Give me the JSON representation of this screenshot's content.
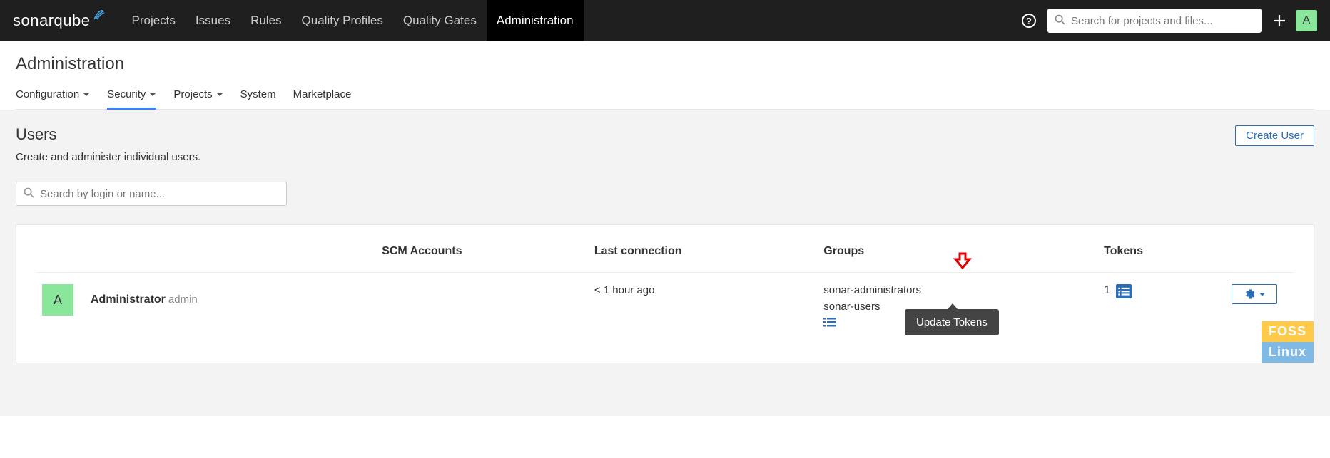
{
  "brand": {
    "part1": "sonar",
    "part2": "qube"
  },
  "topnav": {
    "items": [
      "Projects",
      "Issues",
      "Rules",
      "Quality Profiles",
      "Quality Gates",
      "Administration"
    ],
    "active_index": 5,
    "search_placeholder": "Search for projects and files...",
    "avatar_initial": "A"
  },
  "page": {
    "title": "Administration",
    "subnav": [
      {
        "label": "Configuration",
        "caret": true
      },
      {
        "label": "Security",
        "caret": true
      },
      {
        "label": "Projects",
        "caret": true
      },
      {
        "label": "System",
        "caret": false
      },
      {
        "label": "Marketplace",
        "caret": false
      }
    ],
    "subnav_active_index": 1
  },
  "section": {
    "title": "Users",
    "description": "Create and administer individual users.",
    "create_button": "Create User",
    "search_placeholder": "Search by login or name..."
  },
  "table": {
    "headers": {
      "scm": "SCM Accounts",
      "last": "Last connection",
      "groups": "Groups",
      "tokens": "Tokens"
    },
    "rows": [
      {
        "avatar_initial": "A",
        "name": "Administrator",
        "login": "admin",
        "scm": "",
        "last": "< 1 hour ago",
        "groups": [
          "sonar-administrators",
          "sonar-users"
        ],
        "tokens": "1"
      }
    ]
  },
  "tooltip": {
    "update_tokens": "Update Tokens"
  },
  "watermark": {
    "top": "FOSS",
    "bottom": "Linux"
  }
}
